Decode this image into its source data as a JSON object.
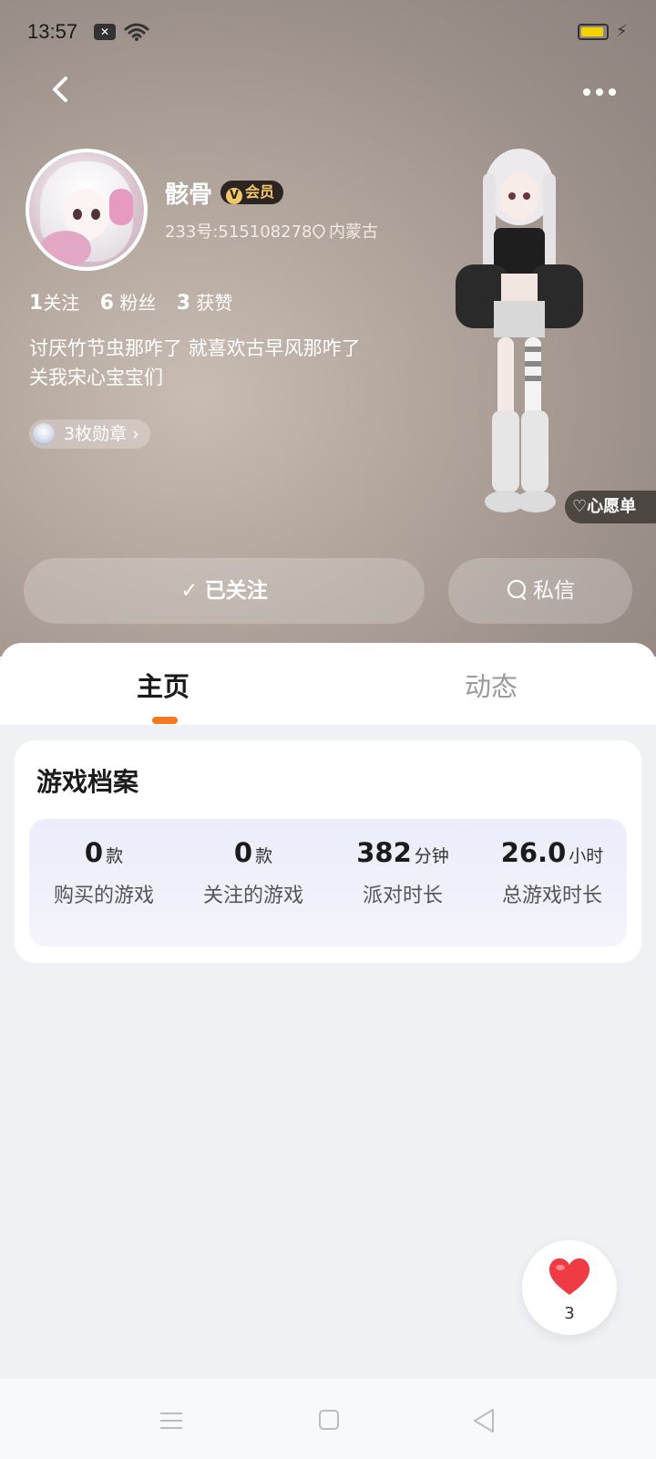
{
  "status_bar": {
    "time": "13:57",
    "notif_badge": "✕"
  },
  "profile": {
    "name": "骸骨",
    "vip_label": "会员",
    "vip_icon": "V",
    "uid": "233号:515108278",
    "location": "内蒙古",
    "stats": [
      {
        "num": "1",
        "label": "关注"
      },
      {
        "num": "6",
        "label": "粉丝"
      },
      {
        "num": "3",
        "label": "获赞"
      }
    ],
    "bio": [
      "讨厌竹节虫那咋了 就喜欢古早风那咋了",
      "关我宋心宝宝们"
    ],
    "badges_label": "3枚勋章",
    "wishlist_label": "心愿单"
  },
  "actions": {
    "follow_label": "已关注",
    "message_label": "私信"
  },
  "tabs": [
    {
      "label": "主页"
    },
    {
      "label": "动态"
    }
  ],
  "game_card": {
    "title": "游戏档案",
    "items": [
      {
        "value": "0",
        "unit": "款",
        "label": "购买的游戏"
      },
      {
        "value": "0",
        "unit": "款",
        "label": "关注的游戏"
      },
      {
        "value": "382",
        "unit": "分钟",
        "label": "派对时长"
      },
      {
        "value": "26.0",
        "unit": "小时",
        "label": "总游戏时长"
      }
    ]
  },
  "fab": {
    "count": "3"
  },
  "colors": {
    "accent": "#f57a1f",
    "vip_gold": "#f4c76a",
    "heart": "#ee3b44"
  }
}
